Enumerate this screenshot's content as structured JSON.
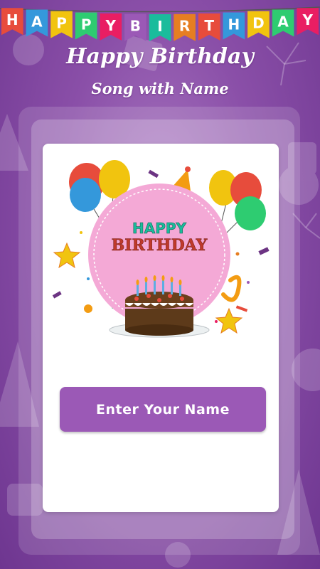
{
  "banner": {
    "letters": [
      "H",
      "A",
      "P",
      "P",
      "Y",
      "B",
      "I",
      "R",
      "T",
      "H",
      "D",
      "A",
      "Y"
    ]
  },
  "header": {
    "title": "Happy Birthday",
    "subtitle": "Song with Name"
  },
  "badge": {
    "line1": "HAPPY",
    "line2": "BIRTHDAY"
  },
  "main": {
    "enter_name_button": "Enter Your Name"
  },
  "colors": {
    "background": "#8a4fa8",
    "button": "#9b59b6",
    "badge_circle": "#f4a9d6"
  }
}
